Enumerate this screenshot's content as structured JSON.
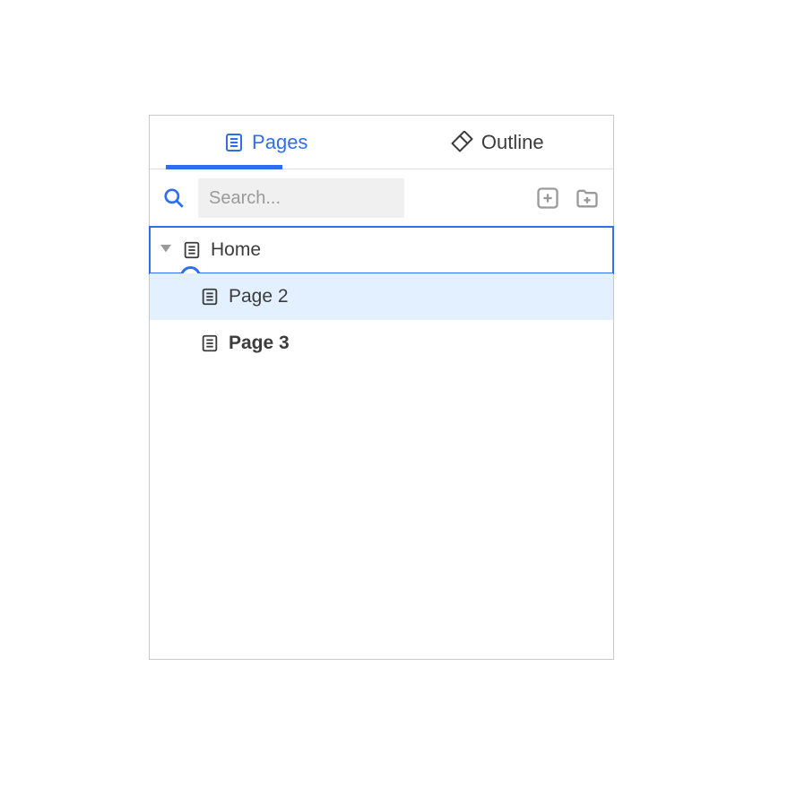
{
  "tabs": {
    "pages": "Pages",
    "outline": "Outline"
  },
  "search": {
    "placeholder": "Search..."
  },
  "tree": {
    "root": {
      "label": "Home"
    },
    "children": [
      {
        "label": "Page 2"
      },
      {
        "label": "Page 3"
      }
    ]
  }
}
